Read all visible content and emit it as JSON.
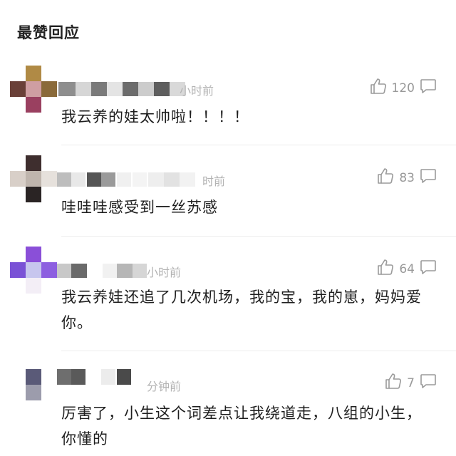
{
  "header": {
    "title": "最赞回应"
  },
  "comments": [
    {
      "time": "小时前",
      "likes": "120",
      "text": "我云养的娃太帅啦！！！！"
    },
    {
      "time": "时前",
      "likes": "83",
      "text": "哇哇哇感受到一丝苏感"
    },
    {
      "time": "小时前",
      "likes": "64",
      "text": "我云养娃还追了几次机场，我的宝，我的崽，妈妈爱你。"
    },
    {
      "time": "分钟前",
      "likes": "7",
      "text": "厉害了，小生这个词差点让我绕道走，八组的小生，你懂的"
    }
  ],
  "icons": {
    "like": "thumbs-up-icon",
    "reply": "comment-bubble-icon"
  },
  "colors": {
    "text": "#1e1e1e",
    "meta": "#999999",
    "divider": "#ececec"
  }
}
